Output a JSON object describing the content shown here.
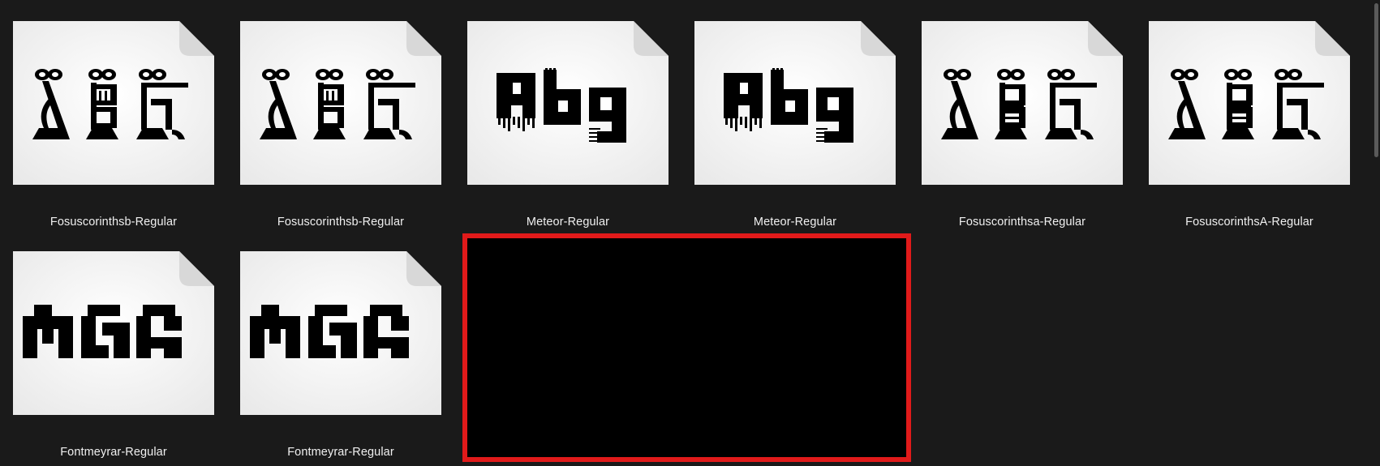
{
  "files": [
    {
      "name": "Fosuscorinthsb-Regular",
      "preview": "fosus-b"
    },
    {
      "name": "Fosuscorinthsb-Regular",
      "preview": "fosus-b"
    },
    {
      "name": "Meteor-Regular",
      "preview": "meteor"
    },
    {
      "name": "Meteor-Regular",
      "preview": "meteor"
    },
    {
      "name": "Fosuscorinthsa-Regular",
      "preview": "fosus-a"
    },
    {
      "name": "FosuscorinthsA-Regular",
      "preview": "fosus-a"
    },
    {
      "name": "Fontmeyrar-Regular",
      "preview": "meyrar"
    },
    {
      "name": "Fontmeyrar-Regular",
      "preview": "meyrar"
    }
  ],
  "icons": {
    "file": "font-file-icon",
    "corner": "page-fold-icon"
  },
  "colors": {
    "background": "#1a1a1a",
    "tile": "#ffffff",
    "label": "#f0f0f0",
    "highlight_border": "#e11a1a",
    "highlight_fill": "#000000"
  }
}
